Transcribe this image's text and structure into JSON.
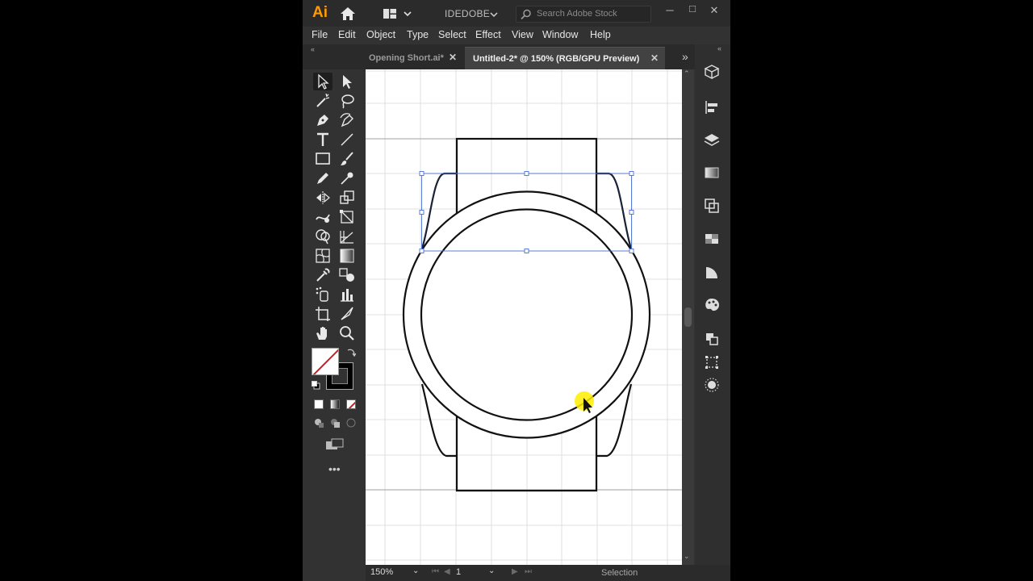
{
  "app": {
    "logo": "Ai",
    "workspace": "IDEDOBE",
    "search_placeholder": "Search Adobe Stock",
    "window_controls": [
      "─",
      "□",
      "✕"
    ]
  },
  "menu": [
    "File",
    "Edit",
    "Object",
    "Type",
    "Select",
    "Effect",
    "View",
    "Window",
    "Help"
  ],
  "tabs": [
    {
      "label": "Opening Short.ai*",
      "close": "✕",
      "active": false
    },
    {
      "label": "Untitled-2* @ 150% (RGB/GPU Preview)",
      "close": "✕",
      "active": true
    }
  ],
  "status": {
    "zoom": "150%",
    "page": "1",
    "tool": "Selection"
  },
  "colors": {
    "accent_logo": "#ff9a00",
    "ui_bg": "#323232",
    "artboard": "#ffffff",
    "selection_blue": "#4a6fd0",
    "cursor_highlight": "#ffee00"
  },
  "icons": {
    "toolbar": [
      "selection-icon",
      "direct-selection-icon",
      "magic-wand-icon",
      "lasso-icon",
      "pen-icon",
      "curvature-icon",
      "type-icon",
      "line-icon",
      "rectangle-icon",
      "paintbrush-icon",
      "pencil-icon",
      "shaper-icon",
      "reflect-icon",
      "scale-icon",
      "warp-icon",
      "free-transform-icon",
      "shape-builder-icon",
      "perspective-icon",
      "mesh-icon",
      "gradient-icon",
      "eyedropper-icon",
      "blend-icon",
      "symbol-sprayer-icon",
      "graph-icon",
      "artboard-icon",
      "slice-icon",
      "hand-icon",
      "zoom-icon"
    ],
    "right_panel": [
      "libraries-icon",
      "align-icon",
      "layers-icon",
      "gradient-panel-icon",
      "pathfinder-icon",
      "transparency-icon",
      "appearance-icon",
      "color-panel-icon",
      "transform-icon",
      "artboards-panel-icon",
      "brightness-icon"
    ]
  }
}
